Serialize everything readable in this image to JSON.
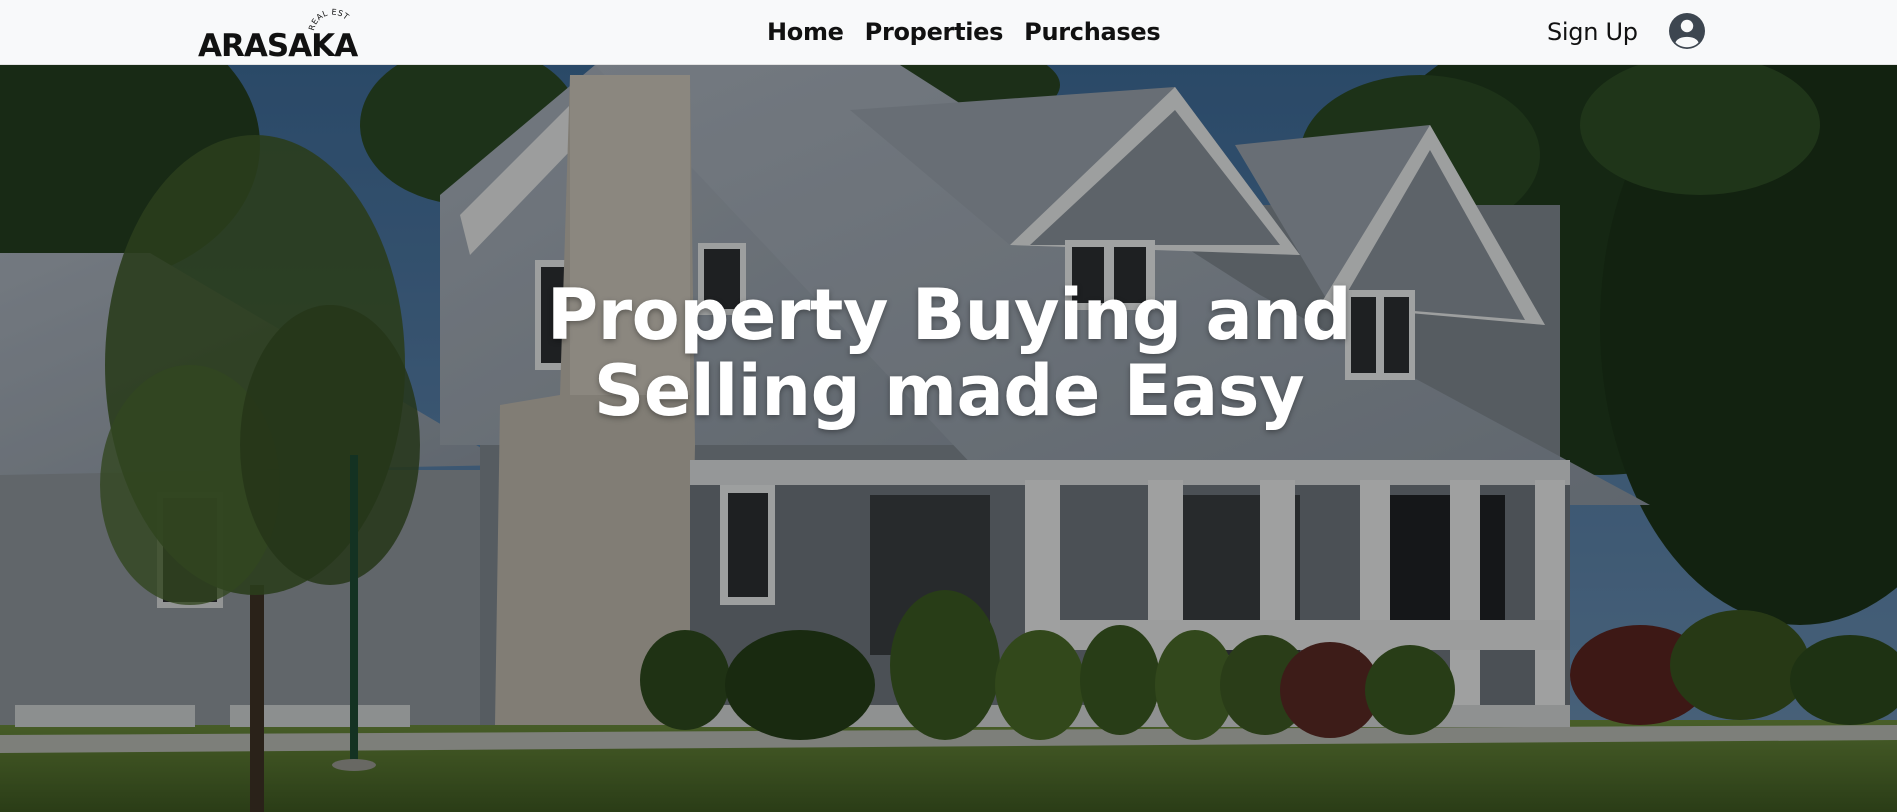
{
  "brand": {
    "logo_text": "ARASAKA",
    "logo_tagline": "REAL ESTATE"
  },
  "nav": {
    "links": [
      {
        "label": "Home"
      },
      {
        "label": "Properties"
      },
      {
        "label": "Purchases"
      }
    ],
    "signup_label": "Sign Up",
    "avatar_icon": "user-circle-icon"
  },
  "hero": {
    "heading_line1": "Property Buying and",
    "heading_line2": "Selling made Easy"
  },
  "colors": {
    "nav_background": "#f8f9fa",
    "text_dark": "#111111",
    "avatar_fill": "#3d4650",
    "hero_text": "#ffffff"
  }
}
